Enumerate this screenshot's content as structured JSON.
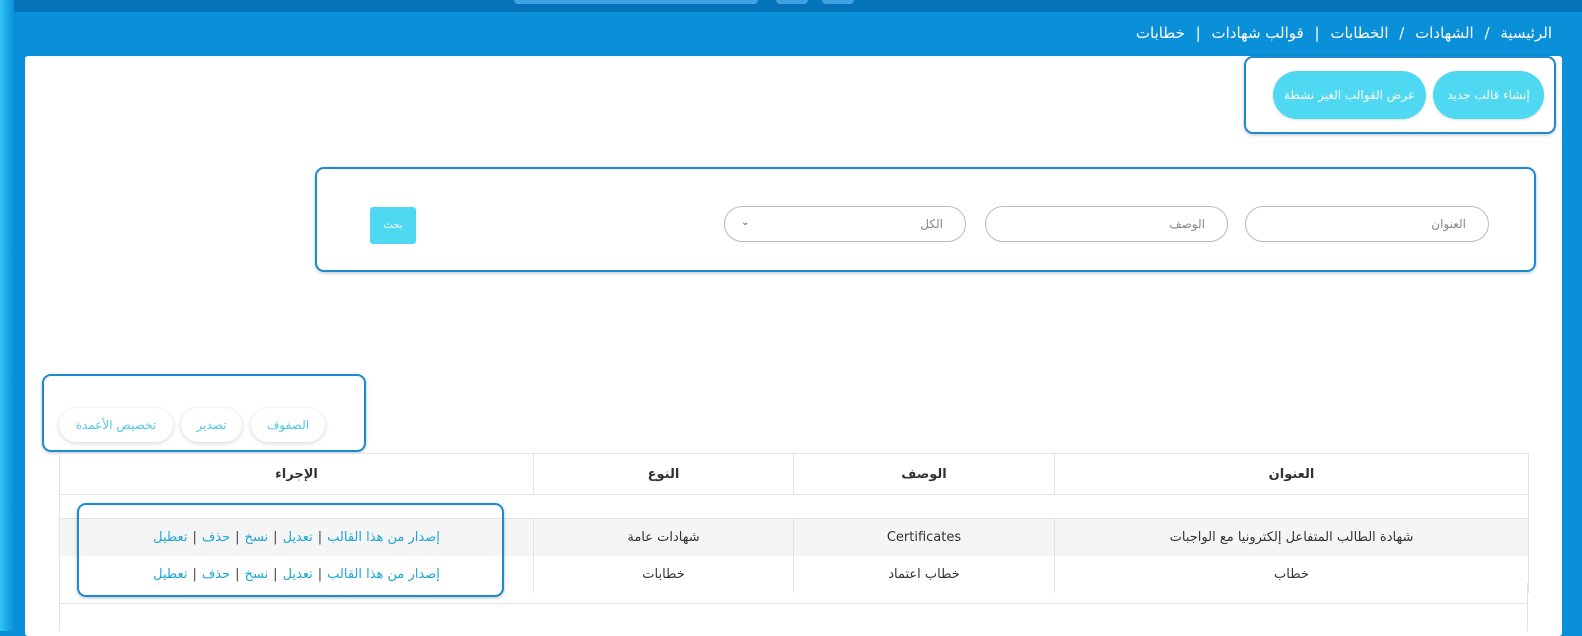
{
  "breadcrumb": {
    "home": "الرئيسية",
    "certificates": "الشهادات",
    "letters": "الخطابات",
    "templates": "قوالب شهادات",
    "current": "خطابات",
    "slash": "/",
    "bar": "|"
  },
  "actions": {
    "create_label": "إنشاء قالب جديد",
    "inactive_label": "عرض القوالب الغير نشطة"
  },
  "filters": {
    "title_placeholder": "العنوان",
    "description_placeholder": "الوصف",
    "type_selected": "الكل",
    "search_label": "بحث"
  },
  "toolbar": {
    "rows_label": "الصفوف",
    "export_label": "تصدير",
    "columns_label": "تخصيص الأعمدة"
  },
  "table": {
    "headers": {
      "title": "العنوان",
      "description": "الوصف",
      "type": "النوع",
      "action": "الإجراء"
    },
    "rows": [
      {
        "title": "شهادة الطالب المتفاعل إلكترونيا مع الواجبات",
        "description": "Certificates",
        "type": "شهادات عامة"
      },
      {
        "title": "خطاب",
        "description": "خطاب اعتماد",
        "type": "خطابات"
      }
    ],
    "row_actions": {
      "issue": "إصدار من هذا القالب",
      "edit": "تعديل",
      "copy": "نسخ",
      "delete": "حذف",
      "disable": "تعطيل",
      "sep": "|"
    }
  },
  "colors": {
    "page_bg": "#0a8fd9",
    "accent_button": "#4fd8f2",
    "highlight_border": "#1a8ad2",
    "link": "#1ba6d6"
  }
}
